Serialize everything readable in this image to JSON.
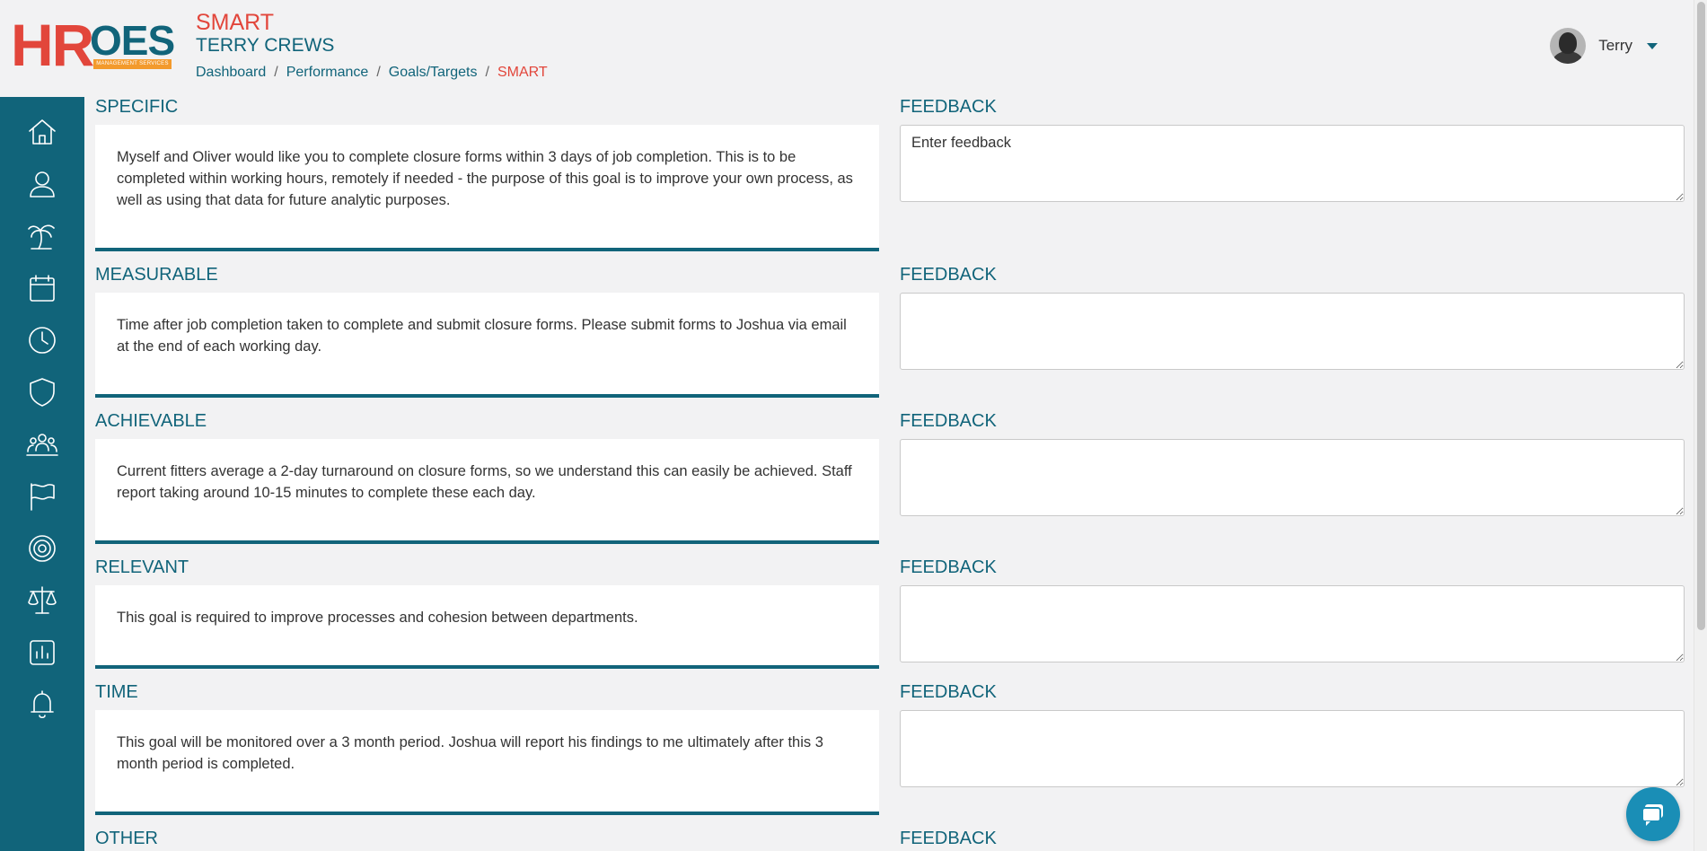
{
  "header": {
    "logo": {
      "hr": "HR",
      "oes": "OES",
      "sub": "MANAGEMENT SERVICES"
    },
    "page_title": "SMART",
    "person_name": "TERRY CREWS",
    "breadcrumb": [
      "Dashboard",
      "Performance",
      "Goals/Targets",
      "SMART"
    ],
    "user": {
      "name": "Terry"
    }
  },
  "sidebar": {
    "items": [
      {
        "icon": "home-icon"
      },
      {
        "icon": "user-icon"
      },
      {
        "icon": "palm-tree-icon"
      },
      {
        "icon": "calendar-icon"
      },
      {
        "icon": "clock-icon"
      },
      {
        "icon": "shield-icon"
      },
      {
        "icon": "team-icon"
      },
      {
        "icon": "flag-icon"
      },
      {
        "icon": "target-icon"
      },
      {
        "icon": "scales-icon"
      },
      {
        "icon": "chart-icon"
      },
      {
        "icon": "bell-icon"
      }
    ]
  },
  "sections": [
    {
      "label": "SPECIFIC",
      "feedback_label": "FEEDBACK",
      "feedback_placeholder": "Enter feedback",
      "text": "Myself and Oliver would like you to complete closure forms within 3 days of job completion. This is to be completed within working hours, remotely if needed - the purpose of this goal is to improve your own process, as well as using that data for future analytic purposes."
    },
    {
      "label": "MEASURABLE",
      "feedback_label": "FEEDBACK",
      "feedback_placeholder": "",
      "text": "Time after job completion taken to complete and submit closure forms. Please submit forms to Joshua via email at the end of each working day."
    },
    {
      "label": "ACHIEVABLE",
      "feedback_label": "FEEDBACK",
      "feedback_placeholder": "",
      "text": "Current fitters average a 2-day turnaround on closure forms, so we understand this can easily be achieved. Staff report taking around 10-15 minutes to complete these each day."
    },
    {
      "label": "RELEVANT",
      "feedback_label": "FEEDBACK",
      "feedback_placeholder": "",
      "text": "This goal is required to improve processes and cohesion between departments."
    },
    {
      "label": "TIME",
      "feedback_label": "FEEDBACK",
      "feedback_placeholder": "",
      "text": "This goal will be monitored over a 3 month period. Joshua will report his findings to me ultimately after this 3 month period is completed."
    },
    {
      "label": "OTHER",
      "feedback_label": "FEEDBACK",
      "feedback_placeholder": "",
      "text": ""
    }
  ],
  "colors": {
    "brand": "#11647a",
    "accent": "#e2463b",
    "logo_orange": "#f39a2c",
    "chat": "#1a8eb6"
  }
}
